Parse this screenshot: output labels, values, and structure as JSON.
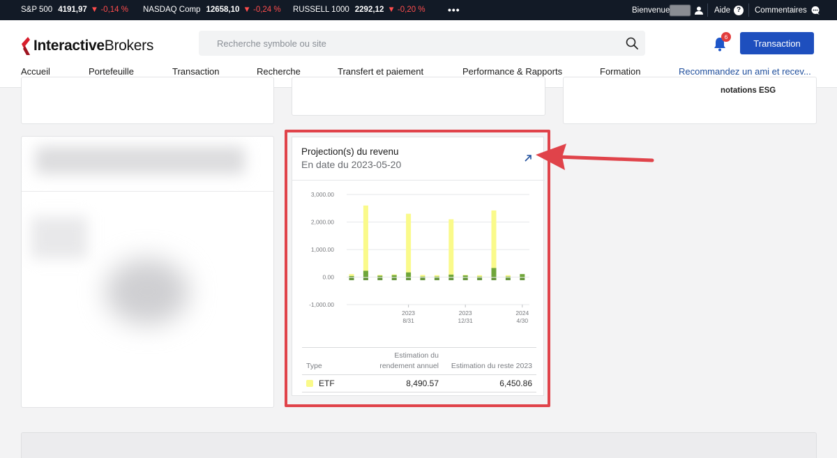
{
  "ticker": [
    {
      "name": "S&P 500",
      "value": "4191,97",
      "change": "▼ -0,14 %"
    },
    {
      "name": "NASDAQ Comp",
      "value": "12658,10",
      "change": "▼ -0,24 %"
    },
    {
      "name": "RUSSELL 1000",
      "value": "2292,12",
      "change": "▼ -0,20 %"
    }
  ],
  "topbar": {
    "more": "•••",
    "welcome": "Bienvenue",
    "help": "Aide",
    "help_glyph": "?",
    "feedback": "Commentaires"
  },
  "header": {
    "logo_part1": "Interactive",
    "logo_part2": "Brokers",
    "search_placeholder": "Recherche symbole ou site",
    "notification_count": "6",
    "transaction_button": "Transaction"
  },
  "nav": [
    "Accueil",
    "Portefeuille",
    "Transaction",
    "Recherche",
    "Transfert et paiement",
    "Performance & Rapports",
    "Formation",
    "Recommandez un ami et recev..."
  ],
  "cards": {
    "esg_label": "notations ESG"
  },
  "projection": {
    "title": "Projection(s) du revenu",
    "date": "En date du 2023-05-20",
    "table": {
      "headers": {
        "type": "Type",
        "annual_line1": "Estimation du",
        "annual_line2": "rendement annuel",
        "rest": "Estimation du reste 2023"
      },
      "rows": [
        {
          "type": "ETF",
          "annual": "8,490.57",
          "rest": "6,450.86"
        }
      ]
    }
  },
  "colors": {
    "accent_button": "#1e4fbe",
    "highlight": "#e0434a",
    "series_etf": "#fafa8a",
    "series_green": "#6fa63a",
    "ticker_down": "#ff4d4d"
  },
  "chart_data": {
    "type": "bar",
    "ylim": [
      -1000,
      3000
    ],
    "yticks": [
      {
        "v": 3000,
        "label": "3,000.00"
      },
      {
        "v": 2000,
        "label": "2,000.00"
      },
      {
        "v": 1000,
        "label": "1,000.00"
      },
      {
        "v": 0,
        "label": "0.00"
      },
      {
        "v": -1000,
        "label": "-1,000.00"
      }
    ],
    "xticks": [
      {
        "at": 4,
        "year": "2023",
        "md": "8/31"
      },
      {
        "at": 8,
        "year": "2023",
        "md": "12/31"
      },
      {
        "at": 12,
        "year": "2024",
        "md": "4/30"
      }
    ],
    "series": [
      {
        "name": "ETF",
        "values": [
          110,
          2600,
          80,
          100,
          2300,
          80,
          70,
          2100,
          80,
          70,
          2420,
          70,
          80
        ]
      },
      {
        "values": [
          40,
          230,
          50,
          70,
          170,
          20,
          20,
          90,
          60,
          20,
          330,
          20,
          110
        ]
      }
    ],
    "negative": [
      -110,
      -110,
      -110,
      -110,
      -110,
      -110,
      -110,
      -110,
      -110,
      -110,
      -110,
      -110,
      -110
    ]
  }
}
